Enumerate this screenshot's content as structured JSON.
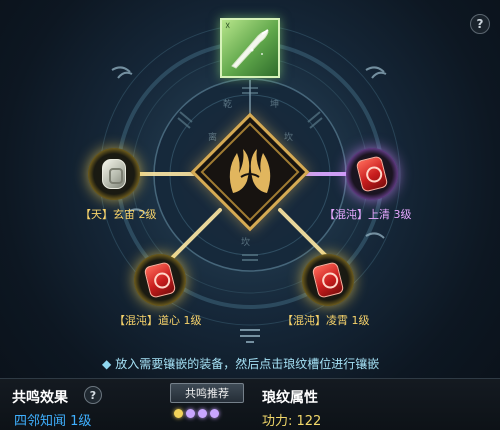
{
  "top_help_icon": "?",
  "equip_slot": {
    "icon": "bone-blade-icon",
    "tag": "☓"
  },
  "center": {
    "icon": "twin-phoenix-emblem-icon"
  },
  "nodes": [
    {
      "id": "top-left",
      "label": "【天】玄宙 2级",
      "style": "gold",
      "gem": "silver"
    },
    {
      "id": "right",
      "label": "【混沌】上清 3级",
      "style": "purple",
      "gem": "red"
    },
    {
      "id": "bottom-left",
      "label": "【混沌】道心 1级",
      "style": "gold",
      "gem": "red"
    },
    {
      "id": "bottom-right",
      "label": "【混沌】凌霄 1级",
      "style": "gold",
      "gem": "red"
    }
  ],
  "hint": {
    "text": "放入需要镶嵌的装备，然后点击琅纹槽位进行镶嵌"
  },
  "resonance": {
    "title": "共鸣效果",
    "value": "四邻知闻 1级",
    "button": "共鸣推荐",
    "help": "?",
    "dots": [
      "#f2d35a",
      "#c9a6ff",
      "#c9a6ff",
      "#c9a6ff"
    ]
  },
  "attributes": {
    "title": "琅纹属性",
    "value": "功力: 122"
  },
  "colors": {
    "gold": "#f7d36b",
    "purple": "#e6a8ff",
    "hint": "#a4e0f4",
    "resonance_value": "#3fb0ff"
  }
}
